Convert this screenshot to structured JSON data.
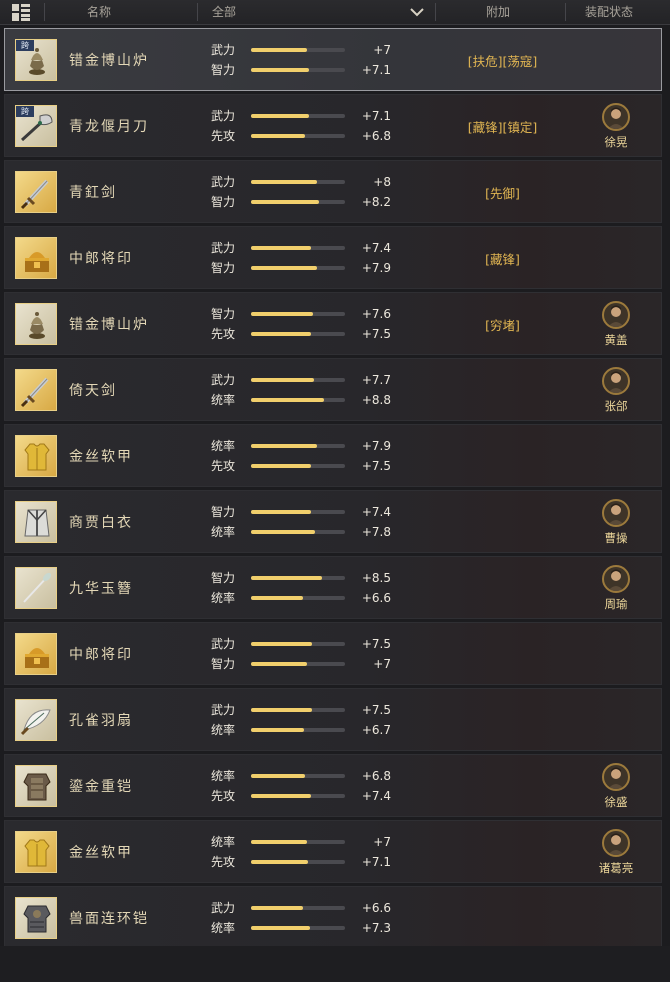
{
  "header": {
    "col_name": "名称",
    "filter_value": "全部",
    "col_extra": "附加",
    "col_status": "装配状态"
  },
  "colors": {
    "stat_bar": "#f1cf6c",
    "extra_text": "#e0b552",
    "hero_name": "#ecd69a"
  },
  "rows": [
    {
      "name": "错金博山炉",
      "icon": "censer-icon",
      "cross": true,
      "cross_label": "跨",
      "selected": true,
      "stats": [
        {
          "label": "武力",
          "value": "+7",
          "fill": 0.6
        },
        {
          "label": "智力",
          "value": "+7.1",
          "fill": 0.62
        }
      ],
      "extra": "[扶危][荡寇]",
      "hero": ""
    },
    {
      "name": "青龙偃月刀",
      "icon": "glaive-icon",
      "cross": true,
      "cross_label": "跨",
      "selected": false,
      "stats": [
        {
          "label": "武力",
          "value": "+7.1",
          "fill": 0.62
        },
        {
          "label": "先攻",
          "value": "+6.8",
          "fill": 0.57
        }
      ],
      "extra": "[藏锋][镇定]",
      "hero": "徐晃"
    },
    {
      "name": "青釭剑",
      "icon": "sword-icon",
      "cross": false,
      "selected": false,
      "stats": [
        {
          "label": "武力",
          "value": "+8",
          "fill": 0.7
        },
        {
          "label": "智力",
          "value": "+8.2",
          "fill": 0.72
        }
      ],
      "extra": "[先御]",
      "hero": ""
    },
    {
      "name": "中郎将印",
      "icon": "seal-box-icon",
      "cross": false,
      "selected": false,
      "stats": [
        {
          "label": "武力",
          "value": "+7.4",
          "fill": 0.64
        },
        {
          "label": "智力",
          "value": "+7.9",
          "fill": 0.7
        }
      ],
      "extra": "[藏锋]",
      "hero": ""
    },
    {
      "name": "错金博山炉",
      "icon": "censer-icon",
      "cross": false,
      "selected": false,
      "stats": [
        {
          "label": "智力",
          "value": "+7.6",
          "fill": 0.66
        },
        {
          "label": "先攻",
          "value": "+7.5",
          "fill": 0.64
        }
      ],
      "extra": "[穷堵]",
      "hero": "黄盖"
    },
    {
      "name": "倚天剑",
      "icon": "sword-icon",
      "cross": false,
      "selected": false,
      "stats": [
        {
          "label": "武力",
          "value": "+7.7",
          "fill": 0.67
        },
        {
          "label": "统率",
          "value": "+8.8",
          "fill": 0.78
        }
      ],
      "extra": "",
      "hero": "张郃"
    },
    {
      "name": "金丝软甲",
      "icon": "vest-icon",
      "cross": false,
      "selected": false,
      "stats": [
        {
          "label": "统率",
          "value": "+7.9",
          "fill": 0.7
        },
        {
          "label": "先攻",
          "value": "+7.5",
          "fill": 0.64
        }
      ],
      "extra": "",
      "hero": ""
    },
    {
      "name": "商贾白衣",
      "icon": "robe-icon",
      "cross": false,
      "selected": false,
      "stats": [
        {
          "label": "智力",
          "value": "+7.4",
          "fill": 0.64
        },
        {
          "label": "统率",
          "value": "+7.8",
          "fill": 0.68
        }
      ],
      "extra": "",
      "hero": "曹操"
    },
    {
      "name": "九华玉簪",
      "icon": "hairpin-icon",
      "cross": false,
      "selected": false,
      "stats": [
        {
          "label": "智力",
          "value": "+8.5",
          "fill": 0.75
        },
        {
          "label": "统率",
          "value": "+6.6",
          "fill": 0.55
        }
      ],
      "extra": "",
      "hero": "周瑜"
    },
    {
      "name": "中郎将印",
      "icon": "seal-box-icon",
      "cross": false,
      "selected": false,
      "stats": [
        {
          "label": "武力",
          "value": "+7.5",
          "fill": 0.65
        },
        {
          "label": "智力",
          "value": "+7",
          "fill": 0.6
        }
      ],
      "extra": "",
      "hero": ""
    },
    {
      "name": "孔雀羽扇",
      "icon": "feather-fan-icon",
      "cross": false,
      "selected": false,
      "stats": [
        {
          "label": "武力",
          "value": "+7.5",
          "fill": 0.65
        },
        {
          "label": "统率",
          "value": "+6.7",
          "fill": 0.56
        }
      ],
      "extra": "",
      "hero": ""
    },
    {
      "name": "鎏金重铠",
      "icon": "heavy-armor-icon",
      "cross": false,
      "selected": false,
      "stats": [
        {
          "label": "统率",
          "value": "+6.8",
          "fill": 0.57
        },
        {
          "label": "先攻",
          "value": "+7.4",
          "fill": 0.64
        }
      ],
      "extra": "",
      "hero": "徐盛"
    },
    {
      "name": "金丝软甲",
      "icon": "vest-icon",
      "cross": false,
      "selected": false,
      "stats": [
        {
          "label": "统率",
          "value": "+7",
          "fill": 0.6
        },
        {
          "label": "先攻",
          "value": "+7.1",
          "fill": 0.61
        }
      ],
      "extra": "",
      "hero": "诸葛亮"
    },
    {
      "name": "兽面连环铠",
      "icon": "chain-armor-icon",
      "cross": false,
      "selected": false,
      "stats": [
        {
          "label": "武力",
          "value": "+6.6",
          "fill": 0.55
        },
        {
          "label": "统率",
          "value": "+7.3",
          "fill": 0.63
        }
      ],
      "extra": "",
      "hero": ""
    }
  ]
}
